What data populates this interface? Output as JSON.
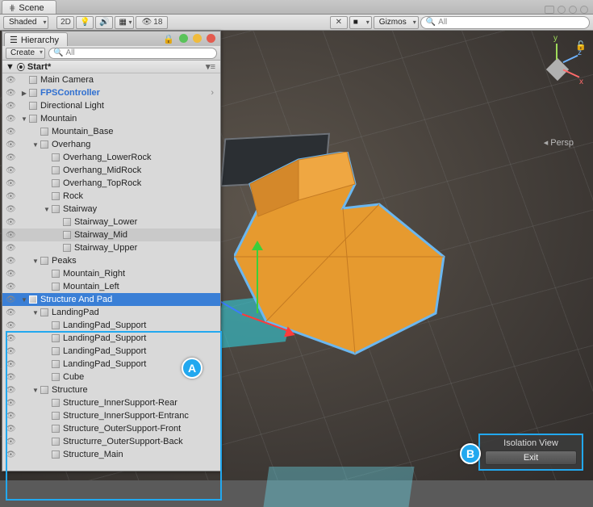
{
  "window": {
    "scene_tab": "Scene"
  },
  "scene_toolbar": {
    "shading": "Shaded",
    "mode_2d": "2D",
    "audio_count": "18",
    "gizmos_label": "Gizmos",
    "search_placeholder": "All"
  },
  "viewport": {
    "persp_label": "Persp",
    "axes": {
      "x": "x",
      "y": "y",
      "z": "z"
    }
  },
  "isolation": {
    "title": "Isolation View",
    "exit": "Exit"
  },
  "hierarchy": {
    "tab": "Hierarchy",
    "create": "Create",
    "search_placeholder": "All",
    "scene_name": "Start*",
    "items": [
      {
        "label": "Main Camera",
        "indent": 1
      },
      {
        "label": "FPSController",
        "indent": 1,
        "fps": true,
        "expandable": true
      },
      {
        "label": "Directional Light",
        "indent": 1
      },
      {
        "label": "Mountain",
        "indent": 1,
        "expanded": true
      },
      {
        "label": "Mountain_Base",
        "indent": 2
      },
      {
        "label": "Overhang",
        "indent": 2,
        "expanded": true
      },
      {
        "label": "Overhang_LowerRock",
        "indent": 3
      },
      {
        "label": "Overhang_MidRock",
        "indent": 3
      },
      {
        "label": "Overhang_TopRock",
        "indent": 3
      },
      {
        "label": "Rock",
        "indent": 3
      },
      {
        "label": "Stairway",
        "indent": 3,
        "expanded": true
      },
      {
        "label": "Stairway_Lower",
        "indent": 4
      },
      {
        "label": "Stairway_Mid",
        "indent": 4,
        "mid": true
      },
      {
        "label": "Stairway_Upper",
        "indent": 4
      },
      {
        "label": "Peaks",
        "indent": 2,
        "expanded": true
      },
      {
        "label": "Mountain_Right",
        "indent": 3
      },
      {
        "label": "Mountain_Left",
        "indent": 3
      },
      {
        "label": "Structure And Pad",
        "indent": 1,
        "expanded": true,
        "selected": true
      },
      {
        "label": "LandingPad",
        "indent": 2,
        "expanded": true
      },
      {
        "label": "LandingPad_Support",
        "indent": 3
      },
      {
        "label": "LandingPad_Support",
        "indent": 3
      },
      {
        "label": "LandingPad_Support",
        "indent": 3
      },
      {
        "label": "LandingPad_Support",
        "indent": 3
      },
      {
        "label": "Cube",
        "indent": 3
      },
      {
        "label": "Structure",
        "indent": 2,
        "expanded": true
      },
      {
        "label": "Structure_InnerSupport-Rear",
        "indent": 3
      },
      {
        "label": "Structure_InnerSupport-Entranc",
        "indent": 3
      },
      {
        "label": "Structure_OuterSupport-Front",
        "indent": 3
      },
      {
        "label": "Structurre_OuterSupport-Back",
        "indent": 3
      },
      {
        "label": "Structure_Main",
        "indent": 3
      }
    ]
  },
  "markers": {
    "a": "A",
    "b": "B"
  }
}
